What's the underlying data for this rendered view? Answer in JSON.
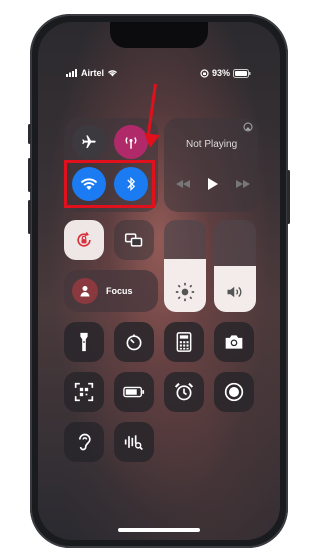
{
  "status_bar": {
    "carrier": "Airtel",
    "battery": "93%"
  },
  "connectivity": {
    "airplane_icon": "airplane-icon",
    "cellular_icon": "antenna-icon",
    "wifi_icon": "wifi-icon",
    "bluetooth_icon": "bluetooth-icon"
  },
  "media": {
    "title": "Not Playing"
  },
  "focus": {
    "label": "Focus"
  },
  "colors": {
    "accent": "#1a7bf2",
    "cellular": "#b02a6a",
    "highlight": "#e0101c"
  }
}
